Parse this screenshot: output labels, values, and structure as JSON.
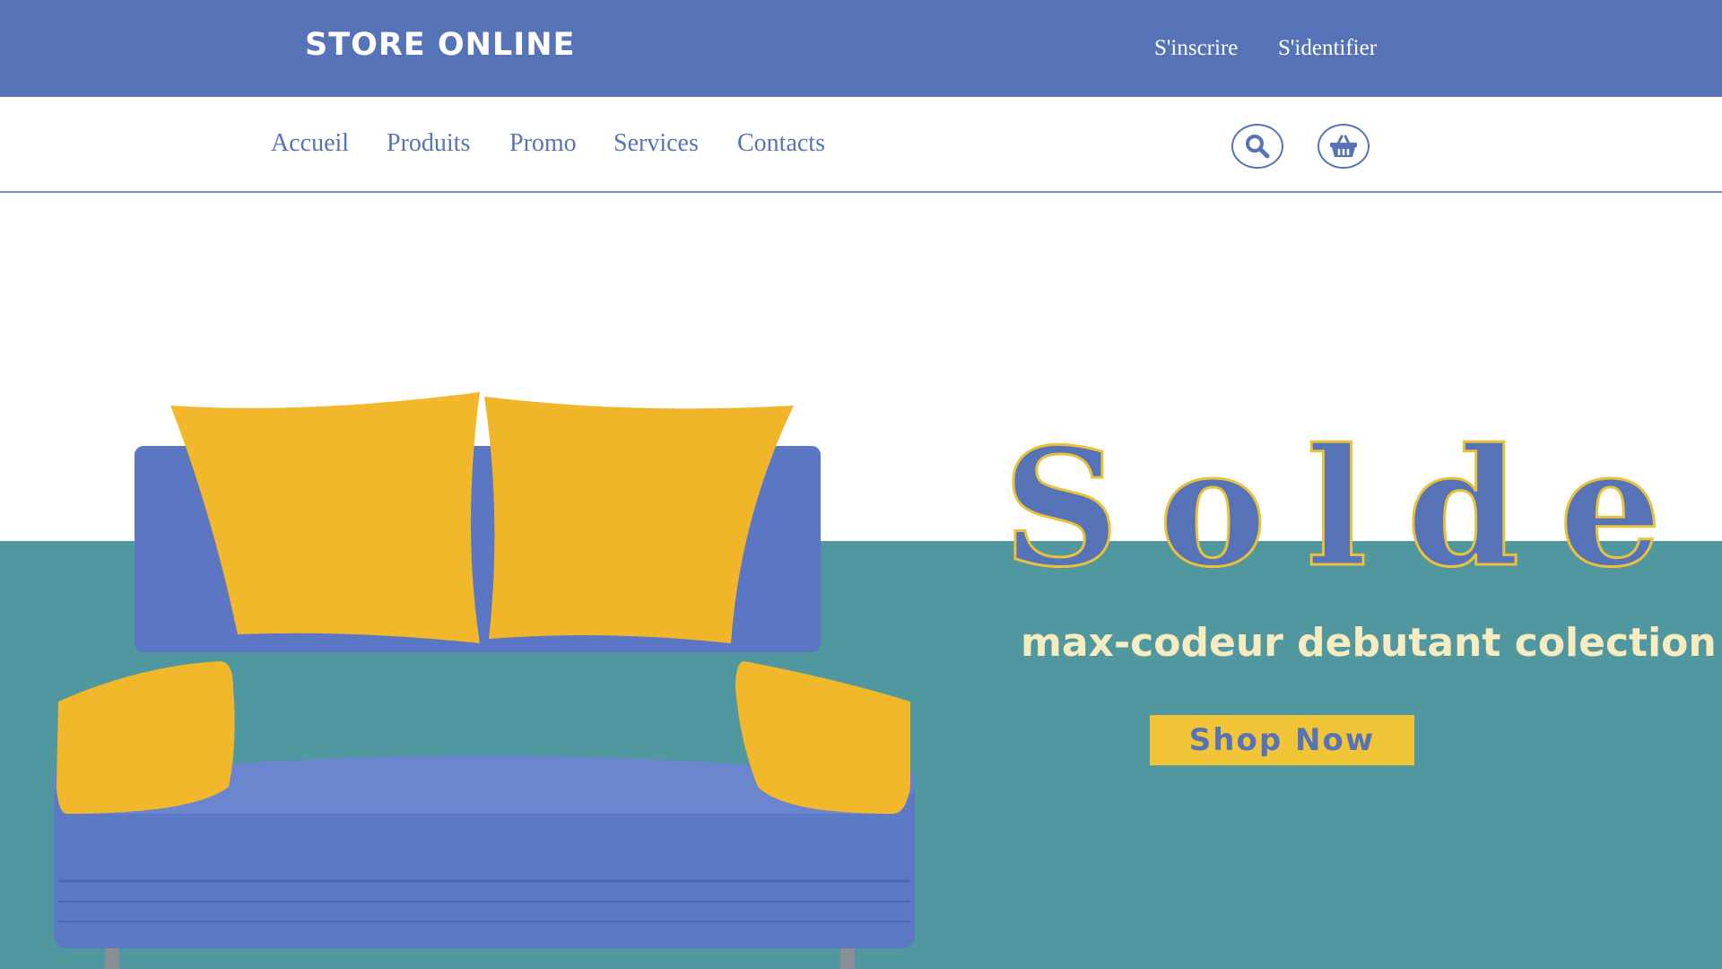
{
  "header": {
    "brand": "STORE ONLINE",
    "register_label": "S'inscrire",
    "login_label": "S'identifier"
  },
  "nav": {
    "items": [
      {
        "label": "Accueil"
      },
      {
        "label": "Produits"
      },
      {
        "label": "Promo"
      },
      {
        "label": "Services"
      },
      {
        "label": "Contacts"
      }
    ],
    "icons": [
      "search-icon",
      "basket-icon"
    ]
  },
  "hero": {
    "title": "Solde",
    "subtitle": "max-codeur debutant colection",
    "cta_label": "Shop Now",
    "image": "sofa-image"
  },
  "colors": {
    "brand_blue": "#5773b8",
    "teal": "#5197a0",
    "yellow": "#f2c537",
    "cream": "#f6ecc0"
  }
}
